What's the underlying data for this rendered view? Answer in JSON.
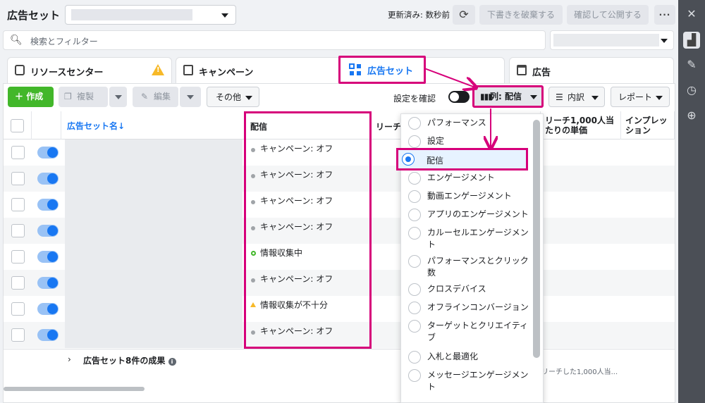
{
  "header": {
    "title": "広告セット",
    "updated_text": "更新済み: 数秒前",
    "discard_label": "下書きを破棄する",
    "publish_label": "確認して公開する",
    "more_label": "···"
  },
  "search": {
    "placeholder": "検索とフィルター"
  },
  "tabs": {
    "resource": "リソースセンター",
    "campaign": "キャンペーン",
    "adset": "広告セット",
    "ad": "広告"
  },
  "toolbar": {
    "create": "作成",
    "duplicate": "複製",
    "edit": "編集",
    "other": "その他",
    "check_settings": "設定を確認",
    "columns": "列: 配信",
    "breakdown": "内訳",
    "report": "レポート"
  },
  "table": {
    "headers": {
      "name": "広告セット名↓",
      "delivery": "配信",
      "reach": "リーチ",
      "cost_per_1000": "リーチ1,000人当たりの単価",
      "impressions": "インプレッション"
    },
    "rows": [
      {
        "delivery": "キャンペーン: オフ",
        "status": "off"
      },
      {
        "delivery": "キャンペーン: オフ",
        "status": "off"
      },
      {
        "delivery": "キャンペーン: オフ",
        "status": "off"
      },
      {
        "delivery": "キャンペーン: オフ",
        "status": "off"
      },
      {
        "delivery": "情報収集中",
        "status": "learning"
      },
      {
        "delivery": "キャンペーン: オフ",
        "status": "off"
      },
      {
        "delivery": "情報収集が不十分",
        "status": "limited"
      },
      {
        "delivery": "キャンペーン: オフ",
        "status": "off"
      }
    ],
    "footer_label": "広告セット8件の成果",
    "footer_note": "リーチした1,000人当..."
  },
  "columns_menu": {
    "options": [
      {
        "label": "パフォーマンス",
        "selected": false
      },
      {
        "label": "設定",
        "selected": false
      },
      {
        "label": "配信",
        "selected": true
      },
      {
        "label": "エンゲージメント",
        "selected": false
      },
      {
        "label": "動画エンゲージメント",
        "selected": false
      },
      {
        "label": "アプリのエンゲージメント",
        "selected": false
      },
      {
        "label": "カルーセルエンゲージメント",
        "selected": false
      },
      {
        "label": "パフォーマンスとクリック数",
        "selected": false
      },
      {
        "label": "クロスデバイス",
        "selected": false
      },
      {
        "label": "オフラインコンバージョン",
        "selected": false
      },
      {
        "label": "ターゲットとクリエイティブ",
        "selected": false
      },
      {
        "label": "入札と最適化",
        "selected": false
      },
      {
        "label": "メッセージエンゲージメント",
        "selected": false
      }
    ]
  },
  "colors": {
    "highlight": "#d6007a",
    "primary": "#1877f2",
    "create_green": "#42b72a",
    "warning": "#f7b928"
  },
  "icons": [
    "search-icon",
    "refresh-icon",
    "warning-icon",
    "chart-icon",
    "pencil-icon",
    "clock-icon",
    "zoom-icon",
    "close-icon"
  ]
}
